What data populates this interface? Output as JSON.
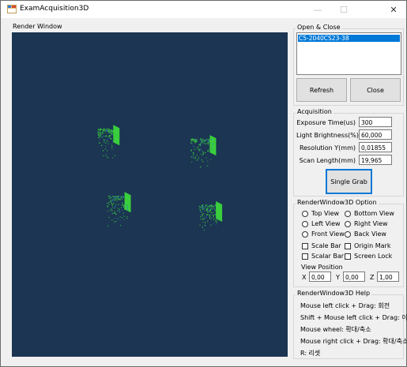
{
  "window": {
    "title": "ExamAcquisition3D"
  },
  "render": {
    "label": "Render Window",
    "background": "#1b3552",
    "cloud_color": "#3cd63c"
  },
  "open_close": {
    "title": "Open & Close",
    "devices": [
      "C5-2040CS23-38"
    ],
    "refresh_label": "Refresh",
    "close_label": "Close"
  },
  "acquisition": {
    "title": "Acquisition",
    "exposure_label": "Exposure Time(us)",
    "exposure_value": "300",
    "brightness_label": "Light Brightness(%)",
    "brightness_value": "60,000",
    "resolution_label": "Resolution Y(mm)",
    "resolution_value": "0,01855",
    "scan_label": "Scan Length(mm)",
    "scan_value": "19,965",
    "grab_label": "Single Grab"
  },
  "options": {
    "title": "RenderWindow3D Option",
    "views": [
      "Top View",
      "Bottom View",
      "Left View",
      "Right View",
      "Front View",
      "Back View"
    ],
    "checks": [
      "Scale Bar",
      "Origin Mark",
      "Scalar Bar",
      "Screen Lock"
    ],
    "position_label": "View Position",
    "x_label": "X",
    "x_value": "0,00",
    "y_label": "Y",
    "y_value": "0,00",
    "z_label": "Z",
    "z_value": "1,00"
  },
  "help": {
    "title": "RenderWindow3D Help",
    "lines": [
      "Mouse left click + Drag: 회전",
      "Shift + Mouse left click + Drag: 이동",
      "Mouse wheel: 확대/축소",
      "Mouse right click + Drag: 확대/축소",
      "R: 리셋"
    ]
  }
}
